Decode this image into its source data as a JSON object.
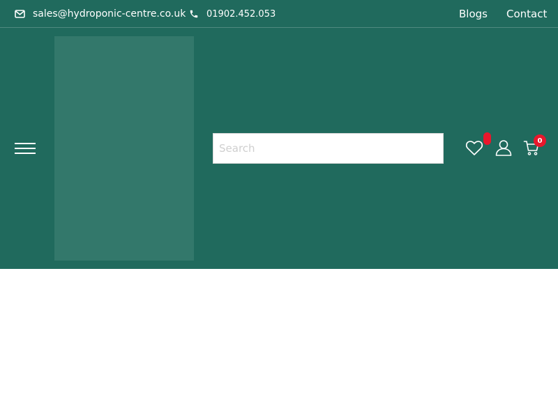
{
  "topbar": {
    "email": "sales@hydroponic-centre.co.uk",
    "phone": "01902.452.053",
    "nav": [
      "Blogs",
      "Contact"
    ]
  },
  "header": {
    "search_placeholder": "Search",
    "cart_count": "0"
  },
  "colors": {
    "brand": "#206a5d",
    "logo_placeholder": "#33786b",
    "badge": "#e8172c"
  },
  "icons": [
    "envelope-icon",
    "phone-icon",
    "hamburger-icon",
    "heart-icon",
    "user-icon",
    "cart-icon"
  ]
}
